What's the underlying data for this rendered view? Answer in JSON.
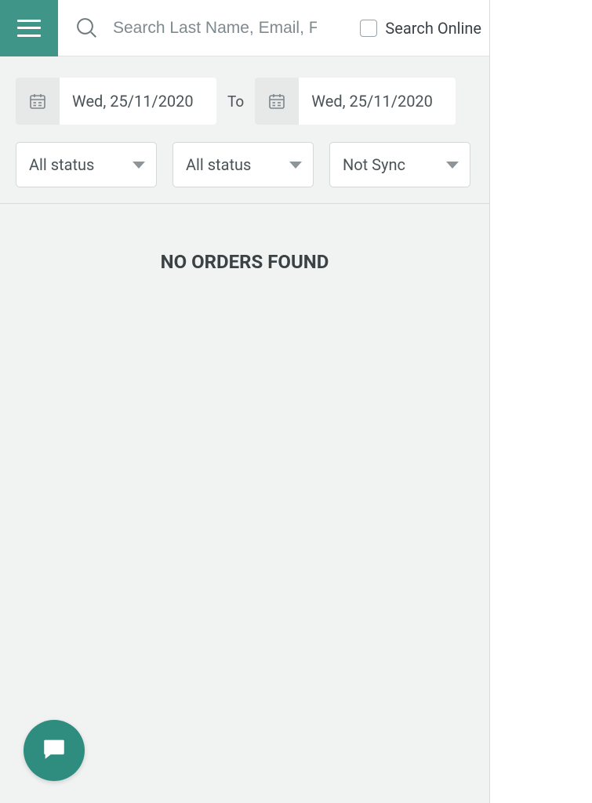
{
  "header": {
    "search_placeholder": "Search Last Name, Email, Fir...",
    "search_online_label": "Search Online"
  },
  "filters": {
    "date_from": "Wed, 25/11/2020",
    "date_to_label": "To",
    "date_to": "Wed, 25/11/2020",
    "status1": "All status",
    "status2": "All status",
    "sync": "Not Sync"
  },
  "main": {
    "empty_message": "NO ORDERS FOUND"
  },
  "icons": {
    "menu": "hamburger-icon",
    "search": "search-icon",
    "calendar": "calendar-icon",
    "chat": "chat-icon"
  },
  "colors": {
    "accent": "#3f9587",
    "chat": "#2f8d7f"
  }
}
